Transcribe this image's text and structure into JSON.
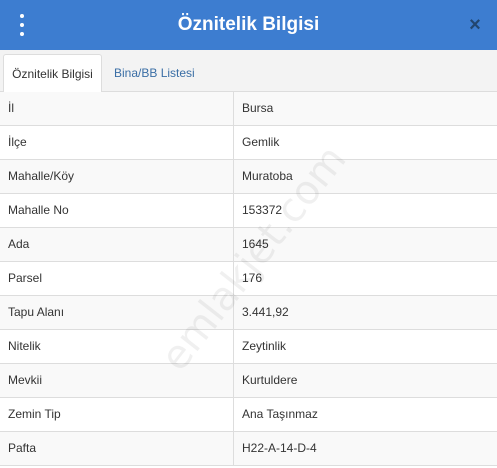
{
  "header": {
    "title": "Öznitelik Bilgisi",
    "close_glyph": "×",
    "menu_icon": "vertical-dots-icon",
    "close_icon": "close-icon"
  },
  "tabs": [
    {
      "label": "Öznitelik Bilgisi",
      "active": true
    },
    {
      "label": "Bina/BB Listesi",
      "active": false
    }
  ],
  "rows": [
    {
      "key": "İl",
      "value": "Bursa"
    },
    {
      "key": "İlçe",
      "value": "Gemlik"
    },
    {
      "key": "Mahalle/Köy",
      "value": "Muratoba"
    },
    {
      "key": "Mahalle No",
      "value": "153372"
    },
    {
      "key": "Ada",
      "value": "1645"
    },
    {
      "key": "Parsel",
      "value": "176"
    },
    {
      "key": "Tapu Alanı",
      "value": "3.441,92"
    },
    {
      "key": "Nitelik",
      "value": "Zeytinlik"
    },
    {
      "key": "Mevkii",
      "value": "Kurtuldere"
    },
    {
      "key": "Zemin Tip",
      "value": "Ana Taşınmaz"
    },
    {
      "key": "Pafta",
      "value": "H22-A-14-D-4"
    }
  ],
  "watermark": "emlakjet.com",
  "colors": {
    "header_bg": "#3d7dd0",
    "tab_link": "#3a6ea5",
    "close_icon": "#22466f"
  }
}
